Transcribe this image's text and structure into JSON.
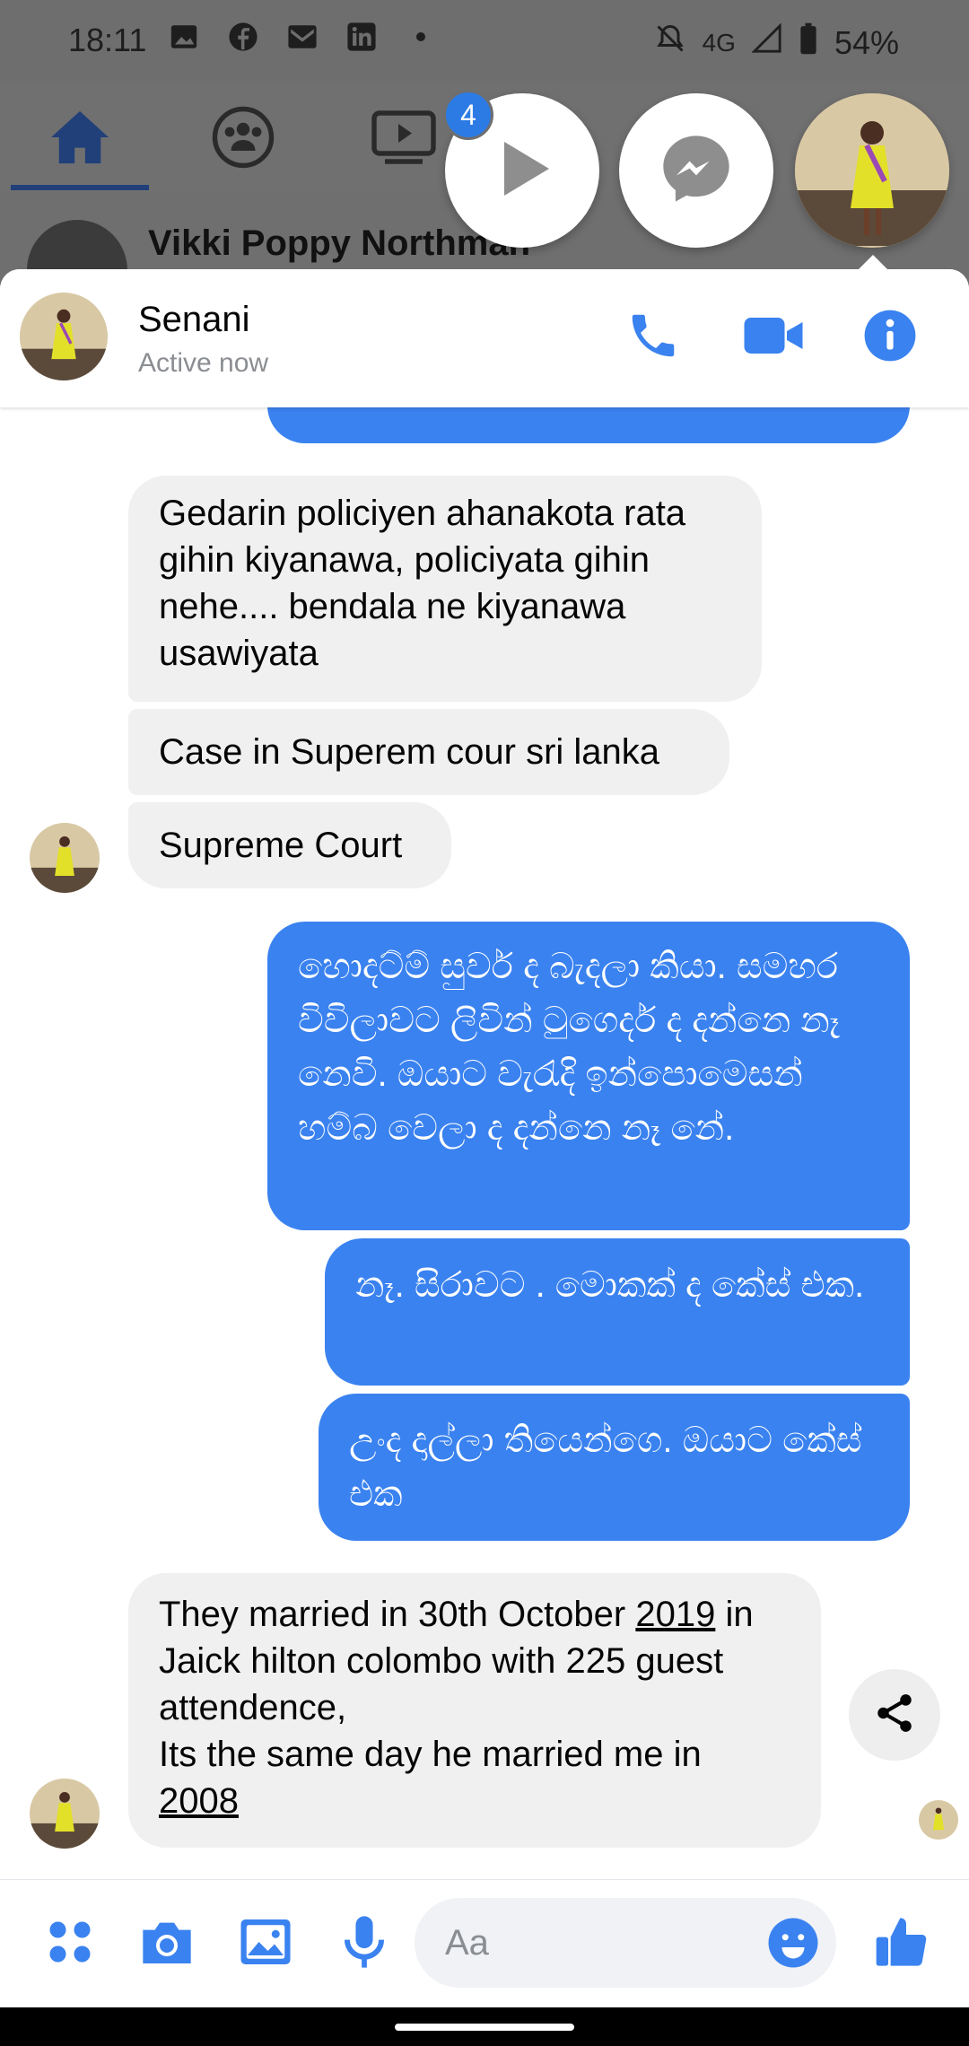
{
  "status_bar": {
    "time": "18:11",
    "network": "4G",
    "battery": "54%"
  },
  "background": {
    "notification_badge": "4",
    "post_author": "Vikki Poppy Northman"
  },
  "chat_header": {
    "name": "Senani",
    "status": "Active now"
  },
  "messages": [
    {
      "side": "in",
      "text": "Gedarin policiyen ahanakota rata gihin kiyanawa, policiyata gihin nehe.... bendala ne kiyanawa usawiyata"
    },
    {
      "side": "in",
      "text": "Case in Superem cour sri lanka"
    },
    {
      "side": "in",
      "text": "Supreme Court"
    },
    {
      "side": "out",
      "text": "හොදට්ම් සුවර් ද බැදලා කියා. සමහර විවිලාවට ලිවින් ටුගෙදර් ද දන්නෙ නෑ නෙවි. ඔයාට වැරැදි ඉන්පොමෙසන් හම්බ වෙලා ද දන්නෙ නෑ නේ."
    },
    {
      "side": "out",
      "text": "නෑ. සිරාවට . මොකක් ද කේස් එක."
    },
    {
      "side": "out",
      "text": "උංද දාල්ලා තියෙන්ගෙ. ඔයාට කේස් එක"
    },
    {
      "side": "in",
      "text_lines": [
        "They married in 30th October ",
        "2019",
        " in Jaick hilton colombo with 225 guest attendence,",
        "Its the same day he married me in ",
        "2008"
      ]
    }
  ],
  "composer": {
    "placeholder": "Aa"
  },
  "icons": {
    "home": "home-icon",
    "groups": "groups-icon",
    "watch": "video-icon",
    "call": "phone-icon",
    "video_call": "video-camera-icon",
    "info": "info-icon",
    "share": "share-icon",
    "apps": "apps-icon",
    "camera": "camera-icon",
    "gallery": "image-icon",
    "mic": "microphone-icon",
    "emoji": "emoji-icon",
    "like": "thumbs-up-icon"
  },
  "colors": {
    "accent": "#3a82f0",
    "incoming_bubble": "#f0f0f0",
    "dim_overlay": "#6e6e6e"
  }
}
